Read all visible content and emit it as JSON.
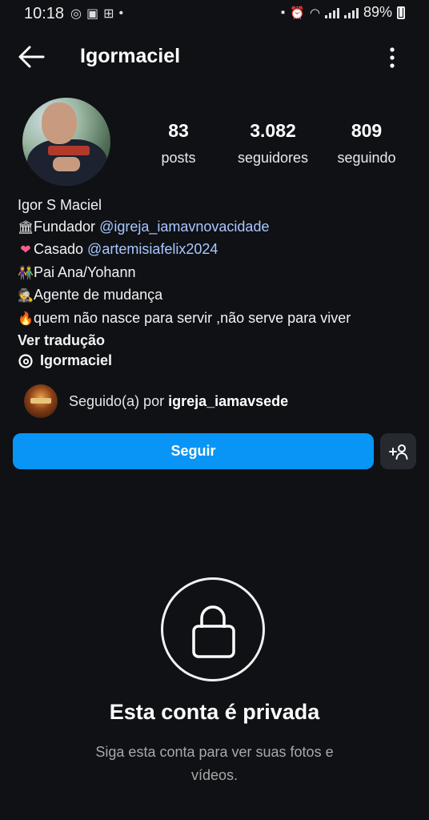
{
  "status_bar": {
    "time": "10:18",
    "battery": "89%"
  },
  "header": {
    "username": "Igormaciel",
    "back_icon": "arrow-left-icon",
    "more_icon": "more-vertical-icon"
  },
  "profile": {
    "stats": [
      {
        "value": "83",
        "label": "posts"
      },
      {
        "value": "3.082",
        "label": "seguidores"
      },
      {
        "value": "809",
        "label": "seguindo"
      }
    ],
    "bio": {
      "name": "Igor S Maciel",
      "line1_text": "Fundador ",
      "line1_mention": "@igreja_iamavnovacidade",
      "line2_text": "Casado  ",
      "line2_mention": "@artemisiafelix2024",
      "line3_text": "Pai Ana/Yohann",
      "line4_text": "Agente de mudança",
      "line5_text": "quem não nasce para servir ,não serve para viver",
      "translate": "Ver tradução"
    },
    "threads_handle": "Igormaciel",
    "followed_by_prefix": "Seguido(a) por ",
    "followed_by_user": "igreja_iamavsede"
  },
  "actions": {
    "follow_label": "Seguir"
  },
  "private": {
    "title": "Esta conta é privada",
    "subtitle": "Siga esta conta para ver suas fotos e vídeos."
  },
  "colors": {
    "background": "#0f1115",
    "follow_button": "#0895f6",
    "mention": "#a9c7ff"
  }
}
